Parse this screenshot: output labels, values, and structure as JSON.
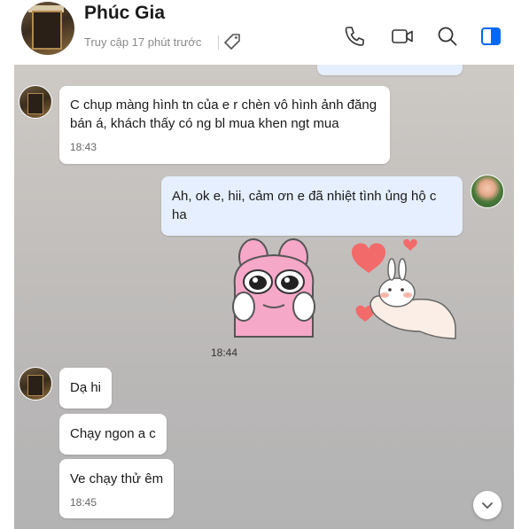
{
  "header": {
    "name": "Phúc Gia",
    "status": "Truy cập 17 phút trước",
    "actions": [
      "phone-icon",
      "video-call-icon",
      "search-icon",
      "sidebar-toggle-icon"
    ]
  },
  "colors": {
    "accent": "#0068ff",
    "my_bubble": "#e5efff",
    "bubble": "#ffffff"
  },
  "messages": [
    {
      "from": "other",
      "text": "C chụp màng hình tn của e r chèn vô hình ảnh đăng bán á, khách thấy có ng bl mua khen ngt mua",
      "time": "18:43"
    },
    {
      "from": "me",
      "text": "Ah, ok e, hii, cảm ơn e đã nhiệt tình ủng hộ c ha"
    },
    {
      "from": "me",
      "type": "stickers",
      "stickers": [
        "pink-bunny-sticker",
        "bunny-hearts-sticker"
      ],
      "time": "18:44"
    },
    {
      "from": "other",
      "text": "Dạ hi"
    },
    {
      "from": "other",
      "text": "Chạy ngon a c"
    },
    {
      "from": "other",
      "text": "Ve chạy thử êm",
      "time": "18:45"
    }
  ]
}
